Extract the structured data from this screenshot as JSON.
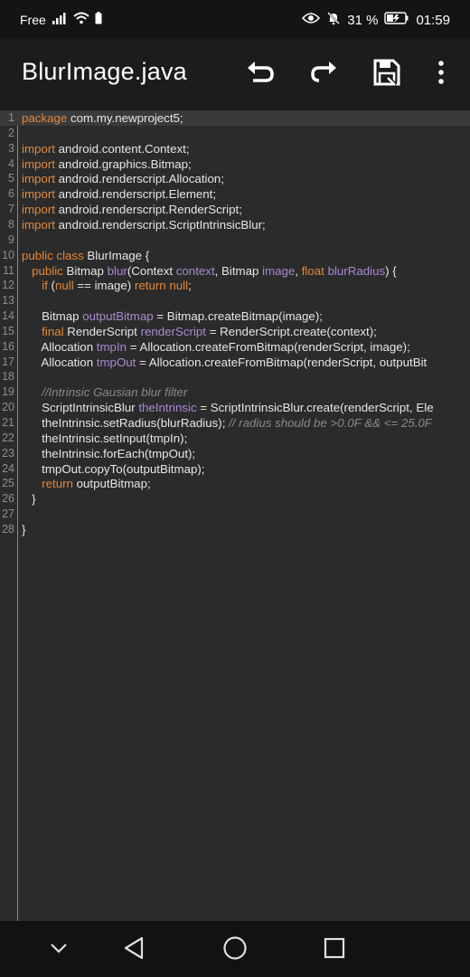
{
  "status_bar": {
    "carrier": "Free",
    "battery_percent": "31 %",
    "time": "01:59"
  },
  "app_bar": {
    "title": "BlurImage.java",
    "actions": [
      "undo-icon",
      "redo-icon",
      "save-icon",
      "more-vert-icon"
    ]
  },
  "editor": {
    "lines": [
      {
        "n": "1",
        "tokens": [
          [
            "kw",
            "package"
          ],
          [
            "t",
            " com.my.newproject5;"
          ]
        ]
      },
      {
        "n": "2",
        "tokens": []
      },
      {
        "n": "3",
        "tokens": [
          [
            "kw",
            "import"
          ],
          [
            "t",
            " android.content.Context;"
          ]
        ]
      },
      {
        "n": "4",
        "tokens": [
          [
            "kw",
            "import"
          ],
          [
            "t",
            " android.graphics.Bitmap;"
          ]
        ]
      },
      {
        "n": "5",
        "tokens": [
          [
            "kw",
            "import"
          ],
          [
            "t",
            " android.renderscript.Allocation;"
          ]
        ]
      },
      {
        "n": "6",
        "tokens": [
          [
            "kw",
            "import"
          ],
          [
            "t",
            " android.renderscript.Element;"
          ]
        ]
      },
      {
        "n": "7",
        "tokens": [
          [
            "kw",
            "import"
          ],
          [
            "t",
            " android.renderscript.RenderScript;"
          ]
        ]
      },
      {
        "n": "8",
        "tokens": [
          [
            "kw",
            "import"
          ],
          [
            "t",
            " android.renderscript.ScriptIntrinsicBlur;"
          ]
        ]
      },
      {
        "n": "9",
        "tokens": []
      },
      {
        "n": "10",
        "tokens": [
          [
            "kw",
            "public class"
          ],
          [
            "t",
            " BlurImage {"
          ]
        ]
      },
      {
        "n": "11",
        "tokens": [
          [
            "t",
            "   "
          ],
          [
            "kw",
            "public"
          ],
          [
            "t",
            " Bitmap "
          ],
          [
            "var",
            "blur"
          ],
          [
            "t",
            "(Context "
          ],
          [
            "var",
            "context"
          ],
          [
            "t",
            ", Bitmap "
          ],
          [
            "var",
            "image"
          ],
          [
            "t",
            ", "
          ],
          [
            "kw",
            "float"
          ],
          [
            "t",
            " "
          ],
          [
            "var",
            "blurRadius"
          ],
          [
            "t",
            ") {"
          ]
        ]
      },
      {
        "n": "12",
        "tokens": [
          [
            "t",
            "      "
          ],
          [
            "kw",
            "if"
          ],
          [
            "t",
            " ("
          ],
          [
            "kw",
            "null"
          ],
          [
            "t",
            " == image) "
          ],
          [
            "kw",
            "return null"
          ],
          [
            "t",
            ";"
          ]
        ]
      },
      {
        "n": "13",
        "tokens": []
      },
      {
        "n": "14",
        "tokens": [
          [
            "t",
            "      Bitmap "
          ],
          [
            "var",
            "outputBitmap"
          ],
          [
            "t",
            " = Bitmap.createBitmap(image);"
          ]
        ]
      },
      {
        "n": "15",
        "tokens": [
          [
            "t",
            "      "
          ],
          [
            "kw",
            "final"
          ],
          [
            "t",
            " RenderScript "
          ],
          [
            "var",
            "renderScript"
          ],
          [
            "t",
            " = RenderScript.create(context);"
          ]
        ]
      },
      {
        "n": "16",
        "tokens": [
          [
            "t",
            "      Allocation "
          ],
          [
            "var",
            "tmpIn"
          ],
          [
            "t",
            " = Allocation.createFromBitmap(renderScript, image);"
          ]
        ]
      },
      {
        "n": "17",
        "tokens": [
          [
            "t",
            "      Allocation "
          ],
          [
            "var",
            "tmpOut"
          ],
          [
            "t",
            " = Allocation.createFromBitmap(renderScript, outputBit"
          ]
        ]
      },
      {
        "n": "18",
        "tokens": []
      },
      {
        "n": "19",
        "tokens": [
          [
            "t",
            "      "
          ],
          [
            "cm",
            "//Intrinsic Gausian blur filter"
          ]
        ]
      },
      {
        "n": "20",
        "tokens": [
          [
            "t",
            "      ScriptIntrinsicBlur "
          ],
          [
            "var",
            "theIntrinsic"
          ],
          [
            "t",
            " = ScriptIntrinsicBlur.create(renderScript, Ele"
          ]
        ]
      },
      {
        "n": "21",
        "tokens": [
          [
            "t",
            "      theIntrinsic.setRadius(blurRadius); "
          ],
          [
            "cm",
            "// radius should be >0.0F && <= 25.0F"
          ]
        ]
      },
      {
        "n": "22",
        "tokens": [
          [
            "t",
            "      theIntrinsic.setInput(tmpIn);"
          ]
        ]
      },
      {
        "n": "23",
        "tokens": [
          [
            "t",
            "      theIntrinsic.forEach(tmpOut);"
          ]
        ]
      },
      {
        "n": "24",
        "tokens": [
          [
            "t",
            "      tmpOut.copyTo(outputBitmap);"
          ]
        ]
      },
      {
        "n": "25",
        "tokens": [
          [
            "t",
            "      "
          ],
          [
            "kw",
            "return"
          ],
          [
            "t",
            " outputBitmap;"
          ]
        ]
      },
      {
        "n": "26",
        "tokens": [
          [
            "t",
            "   }"
          ]
        ]
      },
      {
        "n": "27",
        "tokens": []
      },
      {
        "n": "28",
        "tokens": [
          [
            "t",
            "}"
          ]
        ]
      }
    ]
  },
  "nav_bar": {
    "buttons": [
      "chevron-down-icon",
      "back-icon",
      "home-icon",
      "recents-icon"
    ]
  },
  "colors": {
    "keyword": "#e3873a",
    "variable": "#a98bd0",
    "comment": "#8a8a8a",
    "text": "#e6e6e6",
    "background": "#2b2b2b"
  }
}
